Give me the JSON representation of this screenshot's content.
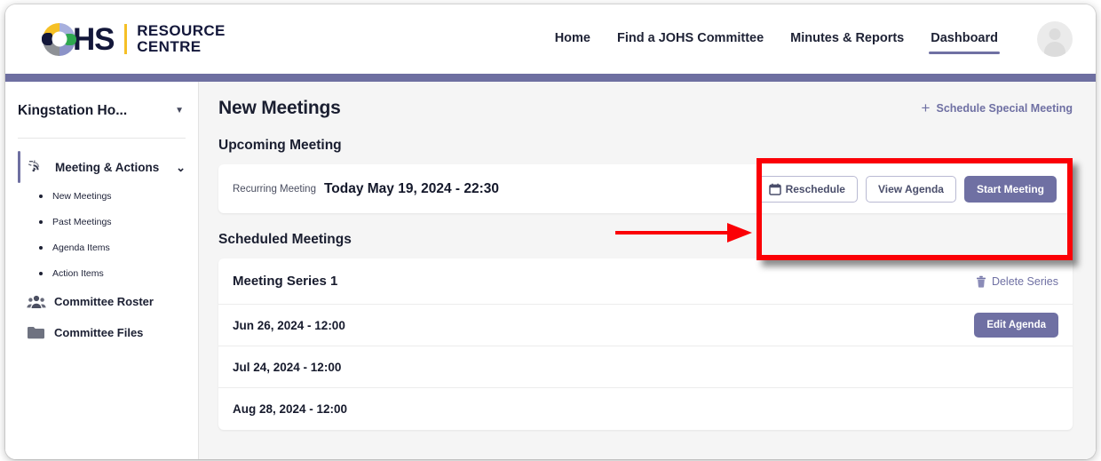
{
  "brand": {
    "logo_icon": "ohs-ring-logo-icon",
    "hs_text": "HS",
    "word_line1": "RESOURCE",
    "word_line2": "CENTRE",
    "accent_yellow": "#f5c026",
    "accent_navy": "#13173a"
  },
  "header": {
    "nav": [
      {
        "label": "Home",
        "active": false
      },
      {
        "label": "Find a JOHS Committee",
        "active": false
      },
      {
        "label": "Minutes & Reports",
        "active": false
      },
      {
        "label": "Dashboard",
        "active": true
      }
    ],
    "avatar_icon": "user-avatar-icon",
    "active_underline_color": "#6f70a3",
    "band_color": "#6e6fa1"
  },
  "sidebar": {
    "org": {
      "name": "Kingstation Ho...",
      "caret_icon": "caret-down-icon"
    },
    "group": {
      "label": "Meeting & Actions",
      "icon": "meeting-actions-icon",
      "chevron_icon": "chevron-down-icon",
      "accent_color": "#6e6fa1",
      "sub_items": [
        {
          "label": "New Meetings"
        },
        {
          "label": "Past Meetings"
        },
        {
          "label": "Agenda Items"
        },
        {
          "label": "Action Items"
        }
      ]
    },
    "items": [
      {
        "label": "Committee Roster",
        "icon": "people-group-icon"
      },
      {
        "label": "Committee Files",
        "icon": "folder-icon"
      }
    ]
  },
  "main": {
    "page_title": "New Meetings",
    "schedule_special": {
      "label": "Schedule Special Meeting",
      "plus_icon": "plus-icon",
      "color": "#6f70a3"
    },
    "upcoming": {
      "section_title": "Upcoming Meeting",
      "type_label": "Recurring Meeting",
      "date_label": "Today May 19, 2024 - 22:30",
      "buttons": [
        {
          "label": "Reschedule",
          "style": "outline",
          "icon": "calendar-icon"
        },
        {
          "label": "View Agenda",
          "style": "outline",
          "icon": ""
        },
        {
          "label": "Start Meeting",
          "style": "primary",
          "icon": ""
        }
      ]
    },
    "scheduled": {
      "section_title": "Scheduled Meetings",
      "series_title": "Meeting Series 1",
      "delete_series": {
        "label": "Delete Series",
        "icon": "trash-icon"
      },
      "rows": [
        {
          "date": "Jun 26, 2024 - 12:00",
          "action_label": "Edit Agenda",
          "has_action": true
        },
        {
          "date": "Jul 24, 2024 - 12:00",
          "action_label": "",
          "has_action": false
        },
        {
          "date": "Aug 28, 2024 - 12:00",
          "action_label": "",
          "has_action": false
        }
      ]
    }
  },
  "annotations": {
    "highlight_color": "#fb0006",
    "box_target": "upcoming-meeting-action-buttons",
    "arrow_direction": "right"
  }
}
